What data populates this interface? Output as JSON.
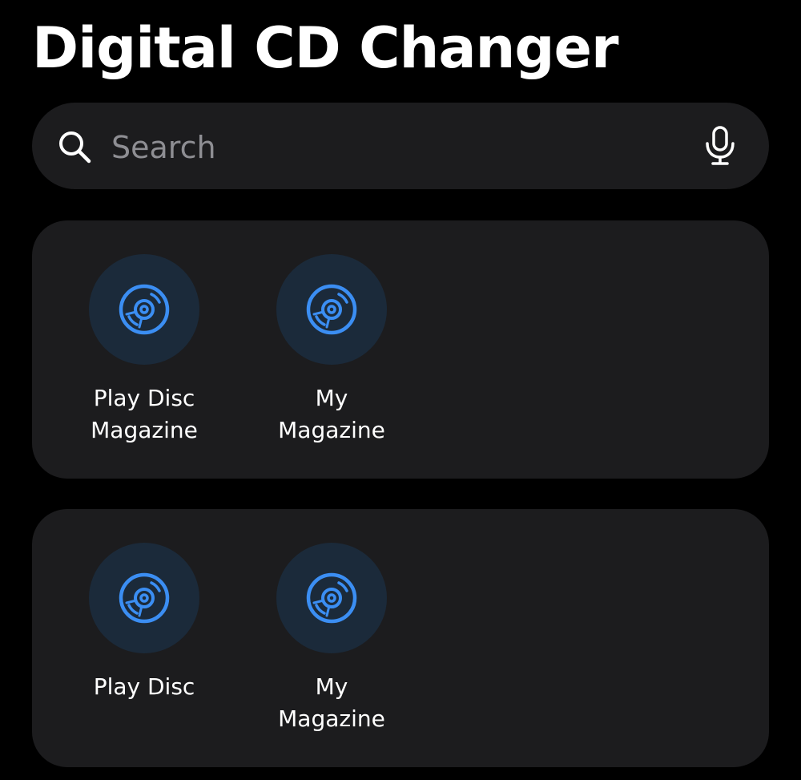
{
  "header": {
    "title": "Digital CD Changer"
  },
  "search": {
    "placeholder": "Search",
    "value": ""
  },
  "icons": {
    "search": "magnifying-glass",
    "microphone": "microphone",
    "disc": "disc"
  },
  "colors": {
    "background": "#000000",
    "card": "#1c1c1e",
    "accent": "#3b8ef3",
    "icon_circle": "#1b2a3a",
    "placeholder": "#8e8e93"
  },
  "groups": [
    {
      "items": [
        {
          "label_lines": [
            "Play Disc",
            "Magazine"
          ],
          "icon": "disc"
        },
        {
          "label_lines": [
            "My",
            "Magazine"
          ],
          "icon": "disc"
        }
      ]
    },
    {
      "items": [
        {
          "label_lines": [
            "Play Disc"
          ],
          "icon": "disc"
        },
        {
          "label_lines": [
            "My",
            "Magazine"
          ],
          "icon": "disc"
        }
      ]
    }
  ]
}
